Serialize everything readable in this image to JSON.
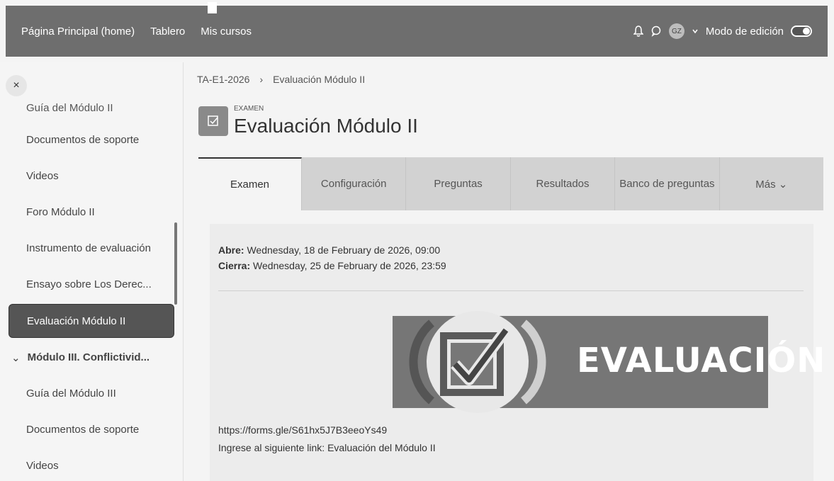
{
  "navbar": {
    "links": [
      "Página Principal (home)",
      "Tablero",
      "Mis cursos"
    ],
    "avatar_initials": "GZ",
    "edit_mode_label": "Modo de edición"
  },
  "sidebar": {
    "close_label": "×",
    "items": [
      "Guía del Módulo II",
      "Documentos de soporte",
      "Videos",
      "Foro Módulo II",
      "Instrumento de evaluación",
      "Ensayo sobre Los Derec...",
      "Evaluación Módulo II",
      "Módulo III. Conflictivid...",
      "Guía del Módulo III",
      "Documentos de soporte",
      "Videos"
    ],
    "section_chevron": "⌄"
  },
  "breadcrumb": {
    "course": "TA-E1-2026",
    "separator": "›",
    "current": "Evaluación Módulo II"
  },
  "activity": {
    "type_label": "EXAMEN",
    "title": "Evaluación Módulo II"
  },
  "tabs": [
    "Examen",
    "Configuración",
    "Preguntas",
    "Resultados",
    "Banco de preguntas",
    "Más ⌄"
  ],
  "content": {
    "open_label": "Abre:",
    "open_value": " Wednesday, 18 de February de 2026, 09:00",
    "close_label": "Cierra:",
    "close_value": " Wednesday, 25 de February de 2026, 23:59",
    "banner_text": "EVALUACIÓN",
    "link_url": "https://forms.gle/S61hx5J7B3eeoYs49",
    "link_note": "Ingrese al siguiente link: Evaluación del Módulo II"
  },
  "colors": {
    "navbar_bg": "#6e6e6e",
    "active_item_bg": "#555555",
    "tab_bar_bg": "#d2d2d2",
    "banner_bg": "#767676"
  }
}
